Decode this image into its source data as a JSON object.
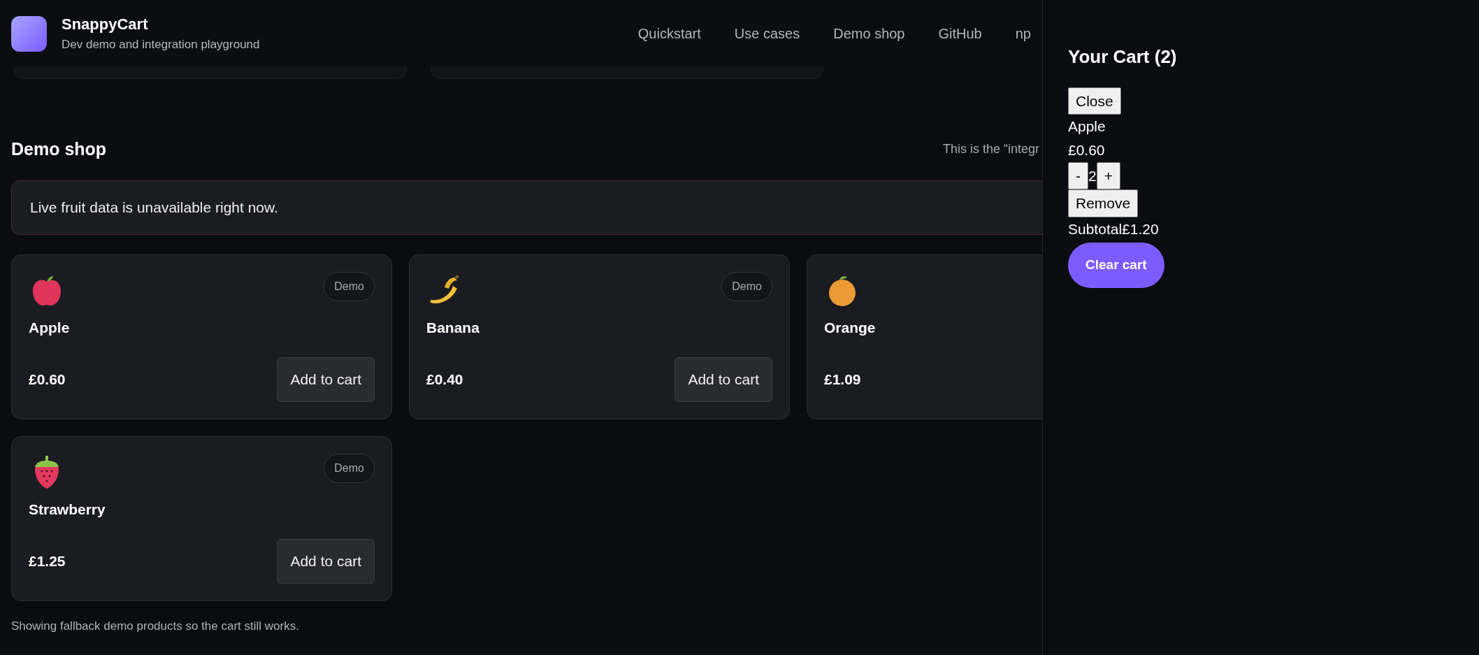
{
  "header": {
    "title": "SnappyCart",
    "subtitle": "Dev demo and integration playground",
    "nav": [
      "Quickstart",
      "Use cases",
      "Demo shop",
      "GitHub",
      "np"
    ]
  },
  "demo_shop": {
    "title": "Demo shop",
    "note": "This is the “integr",
    "alert": "Live fruit data is unavailable right now.",
    "products": [
      {
        "name": "Apple",
        "price": "£0.60",
        "badge": "Demo",
        "button": "Add to cart"
      },
      {
        "name": "Banana",
        "price": "£0.40",
        "badge": "Demo",
        "button": "Add to cart"
      },
      {
        "name": "Orange",
        "price": "£1.09"
      },
      {
        "name": "Strawberry",
        "price": "£1.25",
        "badge": "Demo",
        "button": "Add to cart"
      }
    ],
    "footnote": "Showing fallback demo products so the cart still works."
  },
  "cart": {
    "title": "Your Cart (2)",
    "close": "Close",
    "items": [
      {
        "name": "Apple",
        "price": "£0.60",
        "decrease": "-",
        "quantity": "2",
        "increase": "+",
        "remove": "Remove"
      }
    ],
    "subtotal_label": "Subtotal",
    "subtotal": "£1.20",
    "clear": "Clear cart"
  }
}
